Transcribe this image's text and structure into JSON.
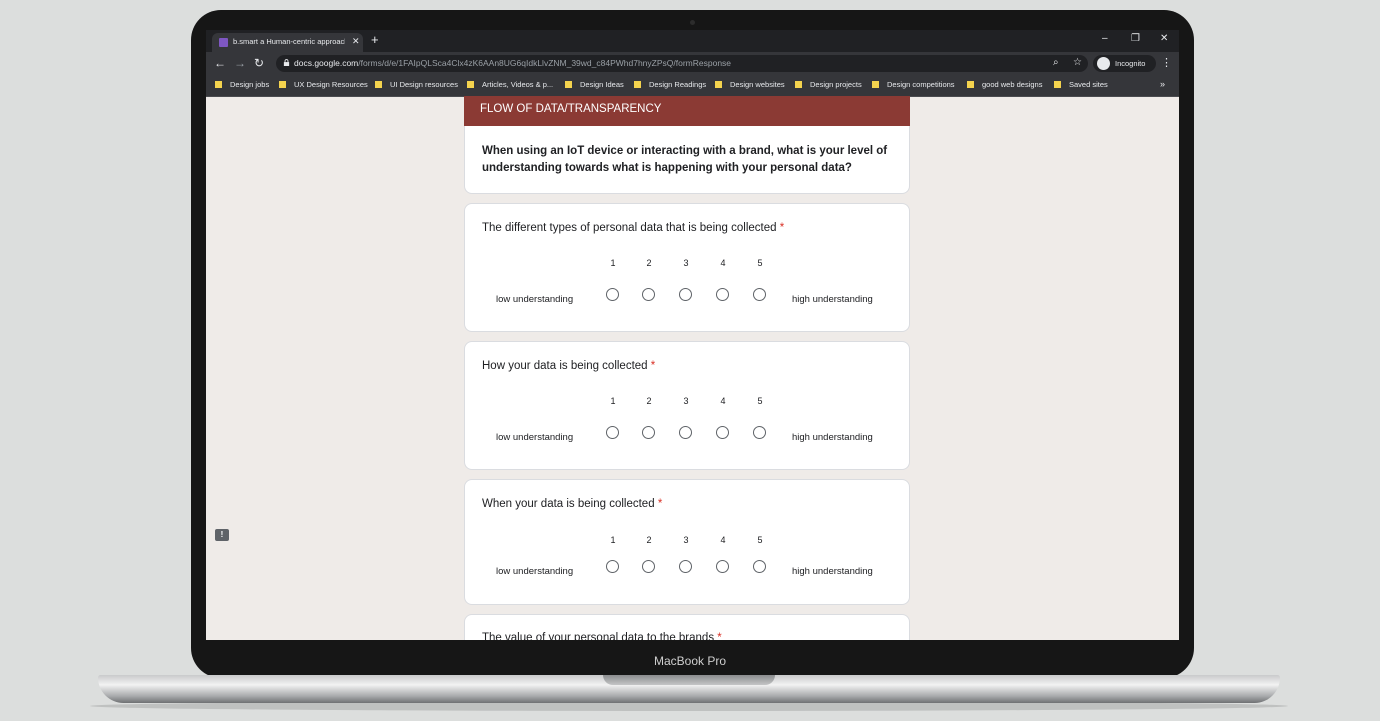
{
  "device": {
    "label": "MacBook Pro"
  },
  "browser": {
    "tab_title": "b.smart a Human-centric approach",
    "tab_close": "✕",
    "new_tab": "+",
    "window_controls": {
      "minimize": "–",
      "restore": "❐",
      "close": "✕"
    },
    "nav": {
      "back": "←",
      "forward": "→",
      "reload": "↻"
    },
    "url_domain": "docs.google.com",
    "url_path": "/forms/d/e/1FAIpQLSca4Clx4zK6AAn8UG6qIdkLlvZNM_39wd_c84PWhd7hnyZPsQ/formResponse",
    "zoom_icon": "⌕",
    "star_icon": "☆",
    "incognito_label": "Incognito",
    "menu_icon": "⋮",
    "bookmarks": [
      "Design jobs",
      "UX Design Resources",
      "UI Design resources",
      "Articles, Videos & p...",
      "Design Ideas",
      "Design Readings",
      "Design websites",
      "Design projects",
      "Design competitions",
      "good web designs",
      "Saved sites"
    ],
    "bookmarks_more": "»"
  },
  "form": {
    "section_title": "FLOW OF DATA/TRANSPARENCY",
    "section_description": "When using an IoT device or interacting with a brand, what is your level of understanding towards what is happening with your personal data?",
    "required_mark": "*",
    "scale": [
      "1",
      "2",
      "3",
      "4",
      "5"
    ],
    "low_label": "low understanding",
    "high_label": "high understanding",
    "questions": [
      "The different types of personal data that is being collected",
      "How your data is being collected",
      "When your data is being collected",
      "The value of your personal data to the brands"
    ],
    "feedback_icon": "!"
  },
  "colors": {
    "header": "#8b3a34",
    "required": "#d93025",
    "bookmark_folder": "#f4d34e"
  }
}
